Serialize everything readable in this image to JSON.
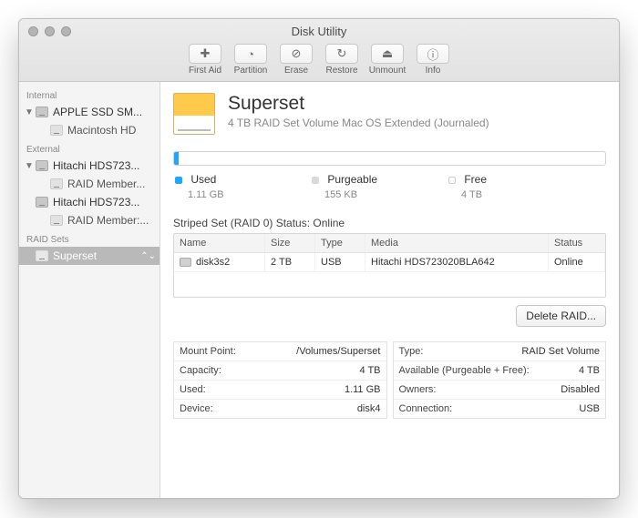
{
  "window": {
    "title": "Disk Utility"
  },
  "toolbar": [
    {
      "id": "first-aid",
      "label": "First Aid",
      "glyph": "✚"
    },
    {
      "id": "partition",
      "label": "Partition",
      "glyph": "◔"
    },
    {
      "id": "erase",
      "label": "Erase",
      "glyph": "⊘"
    },
    {
      "id": "restore",
      "label": "Restore",
      "glyph": "↻"
    },
    {
      "id": "unmount",
      "label": "Unmount",
      "glyph": "⏏"
    },
    {
      "id": "info",
      "label": "Info",
      "glyph": "ⓘ"
    }
  ],
  "sidebar": {
    "sections": [
      {
        "title": "Internal",
        "items": [
          {
            "label": "APPLE SSD SM...",
            "expandable": true,
            "children": [
              {
                "label": "Macintosh HD"
              }
            ]
          }
        ]
      },
      {
        "title": "External",
        "items": [
          {
            "label": "Hitachi HDS723...",
            "expandable": true,
            "children": [
              {
                "label": "RAID Member..."
              }
            ]
          },
          {
            "label": "Hitachi HDS723...",
            "expandable": false,
            "children": [
              {
                "label": "RAID Member:..."
              }
            ]
          }
        ]
      },
      {
        "title": "RAID Sets",
        "items": [
          {
            "label": "Superset",
            "selected": true
          }
        ]
      }
    ]
  },
  "volume": {
    "name": "Superset",
    "subtitle": "4 TB RAID Set Volume Mac OS Extended (Journaled)"
  },
  "usage": {
    "legend": [
      {
        "name": "Used",
        "value": "1.11 GB",
        "color": "#1fa7ff"
      },
      {
        "name": "Purgeable",
        "value": "155 KB",
        "color": "#d9d9d9"
      },
      {
        "name": "Free",
        "value": "4 TB",
        "color": "#ffffff"
      }
    ]
  },
  "raid": {
    "heading": "Striped Set (RAID 0) Status: Online",
    "columns": [
      "Name",
      "Size",
      "Type",
      "Media",
      "Status"
    ],
    "rows": [
      {
        "name": "disk3s2",
        "size": "2 TB",
        "type": "USB",
        "media": "Hitachi HDS723020BLA642",
        "status": "Online"
      }
    ],
    "delete_button": "Delete RAID..."
  },
  "info": {
    "left": [
      {
        "k": "Mount Point:",
        "v": "/Volumes/Superset"
      },
      {
        "k": "Capacity:",
        "v": "4 TB"
      },
      {
        "k": "Used:",
        "v": "1.11 GB"
      },
      {
        "k": "Device:",
        "v": "disk4"
      }
    ],
    "right": [
      {
        "k": "Type:",
        "v": "RAID Set Volume"
      },
      {
        "k": "Available (Purgeable + Free):",
        "v": "4 TB"
      },
      {
        "k": "Owners:",
        "v": "Disabled"
      },
      {
        "k": "Connection:",
        "v": "USB"
      }
    ]
  }
}
